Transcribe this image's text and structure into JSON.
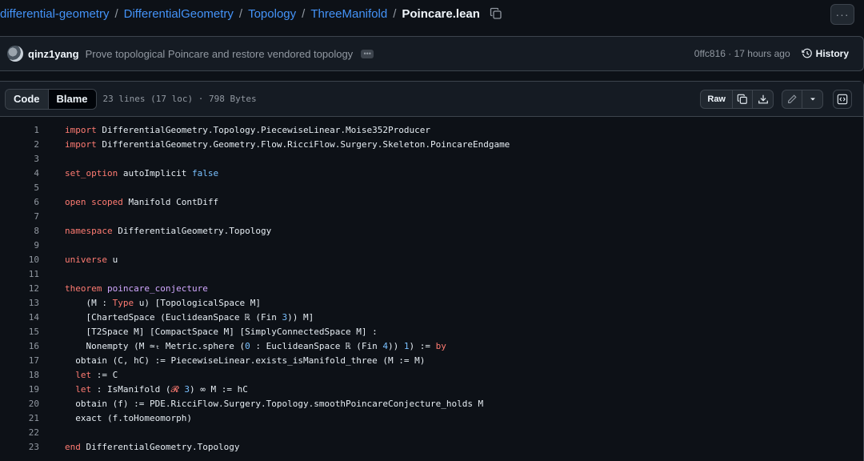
{
  "breadcrumb": {
    "items": [
      "differential-geometry",
      "DifferentialGeometry",
      "Topology",
      "ThreeManifold"
    ],
    "separator": "/",
    "current": "Poincare.lean"
  },
  "commit": {
    "author": "qinz1yang",
    "message": "Prove topological Poincare and restore vendored topology",
    "ellipsis": "•••",
    "sha_time": "0ffc816 · 17 hours ago",
    "history_label": "History"
  },
  "file_header": {
    "code_tab": "Code",
    "blame_tab": "Blame",
    "meta": "23 lines (17 loc) · 798 Bytes",
    "raw_label": "Raw"
  },
  "more_label": "···",
  "colors": {
    "background": "#0d1117",
    "link": "#4493f8",
    "keyword": "#ff7b72",
    "function_name": "#d2a8ff",
    "constant": "#79c0ff",
    "muted": "#9198a1"
  },
  "icons": [
    "copy-icon",
    "kebab-horizontal-icon",
    "history-icon",
    "download-icon",
    "pencil-icon",
    "triangle-down-icon",
    "code-square-icon"
  ],
  "code_lines": [
    {
      "num": "1",
      "tokens": [
        {
          "t": "import",
          "k": "k"
        },
        {
          "t": " DifferentialGeometry.Topology.PiecewiseLinear.Moise352Producer",
          "k": ""
        }
      ]
    },
    {
      "num": "2",
      "tokens": [
        {
          "t": "import",
          "k": "k"
        },
        {
          "t": " DifferentialGeometry.Geometry.Flow.RicciFlow.Surgery.Skeleton.PoincareEndgame",
          "k": ""
        }
      ]
    },
    {
      "num": "3",
      "tokens": []
    },
    {
      "num": "4",
      "tokens": [
        {
          "t": "set_option",
          "k": "k"
        },
        {
          "t": " autoImplicit ",
          "k": ""
        },
        {
          "t": "false",
          "k": "c"
        }
      ]
    },
    {
      "num": "5",
      "tokens": []
    },
    {
      "num": "6",
      "tokens": [
        {
          "t": "open scoped",
          "k": "k"
        },
        {
          "t": " Manifold ContDiff",
          "k": ""
        }
      ]
    },
    {
      "num": "7",
      "tokens": []
    },
    {
      "num": "8",
      "tokens": [
        {
          "t": "namespace",
          "k": "k"
        },
        {
          "t": " DifferentialGeometry.Topology",
          "k": ""
        }
      ]
    },
    {
      "num": "9",
      "tokens": []
    },
    {
      "num": "10",
      "tokens": [
        {
          "t": "universe",
          "k": "k"
        },
        {
          "t": " u",
          "k": ""
        }
      ]
    },
    {
      "num": "11",
      "tokens": []
    },
    {
      "num": "12",
      "tokens": [
        {
          "t": "theorem",
          "k": "k"
        },
        {
          "t": " ",
          "k": ""
        },
        {
          "t": "poincare_conjecture",
          "k": "f"
        }
      ]
    },
    {
      "num": "13",
      "tokens": [
        {
          "t": "    (M : ",
          "k": ""
        },
        {
          "t": "Type",
          "k": "k"
        },
        {
          "t": " u) [TopologicalSpace M]",
          "k": ""
        }
      ]
    },
    {
      "num": "14",
      "tokens": [
        {
          "t": "    [ChartedSpace (EuclideanSpace ℝ (Fin ",
          "k": ""
        },
        {
          "t": "3",
          "k": "c"
        },
        {
          "t": ")) M]",
          "k": ""
        }
      ]
    },
    {
      "num": "15",
      "tokens": [
        {
          "t": "    [T2Space M] [CompactSpace M] [SimplyConnectedSpace M] :",
          "k": ""
        }
      ]
    },
    {
      "num": "16",
      "tokens": [
        {
          "t": "    Nonempty (M ≃ₜ Metric.sphere (",
          "k": ""
        },
        {
          "t": "0",
          "k": "c"
        },
        {
          "t": " : EuclideanSpace ℝ (Fin ",
          "k": ""
        },
        {
          "t": "4",
          "k": "c"
        },
        {
          "t": ")) ",
          "k": ""
        },
        {
          "t": "1",
          "k": "c"
        },
        {
          "t": ") := ",
          "k": ""
        },
        {
          "t": "by",
          "k": "k"
        }
      ]
    },
    {
      "num": "17",
      "tokens": [
        {
          "t": "  obtain (C, hC) := PiecewiseLinear.exists_isManifold_three (M := M)",
          "k": ""
        }
      ]
    },
    {
      "num": "18",
      "tokens": [
        {
          "t": "  ",
          "k": ""
        },
        {
          "t": "let",
          "k": "k"
        },
        {
          "t": " := C",
          "k": ""
        }
      ]
    },
    {
      "num": "19",
      "tokens": [
        {
          "t": "  ",
          "k": ""
        },
        {
          "t": "let",
          "k": "k"
        },
        {
          "t": " : IsManifold (",
          "k": ""
        },
        {
          "t": "𝓡",
          "k": "k"
        },
        {
          "t": " ",
          "k": ""
        },
        {
          "t": "3",
          "k": "c"
        },
        {
          "t": ") ∞ M := hC",
          "k": ""
        }
      ]
    },
    {
      "num": "20",
      "tokens": [
        {
          "t": "  obtain (f) := PDE.RicciFlow.Surgery.Topology.smoothPoincareConjecture_holds M",
          "k": ""
        }
      ]
    },
    {
      "num": "21",
      "tokens": [
        {
          "t": "  exact (f.toHomeomorph)",
          "k": ""
        }
      ]
    },
    {
      "num": "22",
      "tokens": []
    },
    {
      "num": "23",
      "tokens": [
        {
          "t": "end",
          "k": "k"
        },
        {
          "t": " DifferentialGeometry.Topology",
          "k": ""
        }
      ]
    }
  ]
}
